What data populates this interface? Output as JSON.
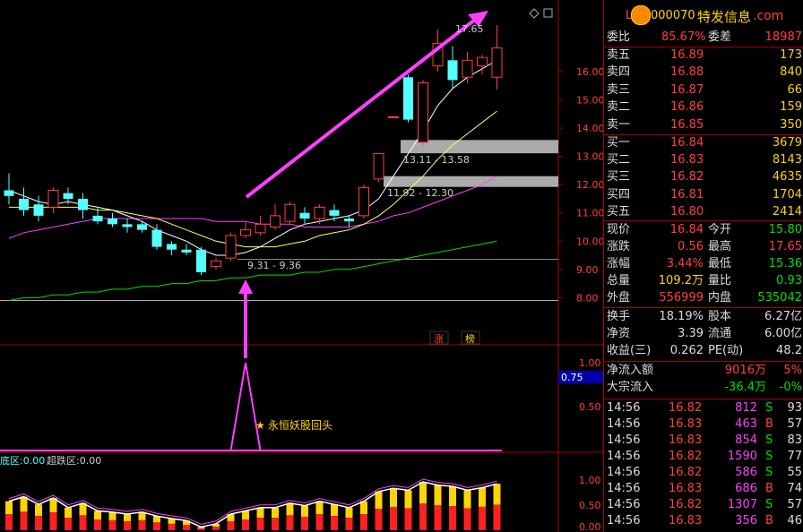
{
  "header": {
    "code": "000070",
    "name": "特发信息",
    "site": ".com",
    "prefix": "L"
  },
  "colors": {
    "up": "#ff4040",
    "down": "#54ffff",
    "ma5": "#ffffff",
    "ma10": "#ffff66",
    "ma20": "#ff40ff",
    "ma60": "#00dd00",
    "accent": "#ff40ff"
  },
  "main_chart": {
    "y_ticks": [
      "16.00",
      "15.00",
      "14.00",
      "13.00",
      "12.00",
      "11.00",
      "10.00",
      "9.00",
      "8.00"
    ],
    "annotations": {
      "high": "17.65",
      "zone_upper": "13.11 - 13.58",
      "zone_mid": "11.92 - 12.30",
      "zone_low": "9.31 - 9.36"
    },
    "badges": [
      "涨",
      "榜"
    ]
  },
  "mid_chart": {
    "y_ticks": [
      "1.00",
      "0.50"
    ],
    "current": "0.75",
    "signal_label": "永恒妖股回头"
  },
  "bottom_chart": {
    "label1": "底区:",
    "value1": "0.00",
    "label2": "超跌区:",
    "value2": "0.00",
    "y_ticks": [
      "1.00",
      "0.50",
      "0.00"
    ]
  },
  "quote": {
    "weibi_label": "委比",
    "weibi": "85.67%",
    "weicha_label": "委差",
    "weicha": "18987",
    "asks": [
      {
        "label": "卖五",
        "price": "16.89",
        "vol": "173"
      },
      {
        "label": "卖四",
        "price": "16.88",
        "vol": "840"
      },
      {
        "label": "卖三",
        "price": "16.87",
        "vol": "66"
      },
      {
        "label": "卖二",
        "price": "16.86",
        "vol": "159"
      },
      {
        "label": "卖一",
        "price": "16.85",
        "vol": "350"
      }
    ],
    "bids": [
      {
        "label": "买一",
        "price": "16.84",
        "vol": "3679"
      },
      {
        "label": "买二",
        "price": "16.83",
        "vol": "8143"
      },
      {
        "label": "买三",
        "price": "16.82",
        "vol": "4635"
      },
      {
        "label": "买四",
        "price": "16.81",
        "vol": "1704"
      },
      {
        "label": "买五",
        "price": "16.80",
        "vol": "2414"
      }
    ],
    "stats": [
      {
        "l1": "现价",
        "v1": "16.84",
        "c1": "r",
        "l2": "今开",
        "v2": "15.80",
        "c2": "g"
      },
      {
        "l1": "涨跌",
        "v1": "0.56",
        "c1": "r",
        "l2": "最高",
        "v2": "17.65",
        "c2": "r"
      },
      {
        "l1": "涨幅",
        "v1": "3.44%",
        "c1": "r",
        "l2": "最低",
        "v2": "15.36",
        "c2": "g"
      },
      {
        "l1": "总量",
        "v1": "109.2万",
        "c1": "y",
        "l2": "量比",
        "v2": "0.93",
        "c2": "g"
      },
      {
        "l1": "外盘",
        "v1": "556999",
        "c1": "r",
        "l2": "内盘",
        "v2": "535042",
        "c2": "g"
      }
    ],
    "stats2": [
      {
        "l1": "换手",
        "v1": "18.19%",
        "l2": "股本",
        "v2": "6.27亿"
      },
      {
        "l1": "净资",
        "v1": "3.39",
        "l2": "流通",
        "v2": "6.00亿"
      },
      {
        "l1": "收益(三)",
        "v1": "0.262",
        "l2": "PE(动)",
        "v2": "48.2"
      }
    ],
    "flow": [
      {
        "label": "净流入额",
        "value": "9016万",
        "pct": "5%",
        "color": "r"
      },
      {
        "label": "大宗流入",
        "value": "-36.4万",
        "pct": "-0%",
        "color": "g"
      }
    ],
    "ticks": [
      {
        "time": "14:56",
        "price": "16.82",
        "vol": "812",
        "side": "S",
        "n": "93"
      },
      {
        "time": "14:56",
        "price": "16.83",
        "vol": "463",
        "side": "B",
        "n": "57"
      },
      {
        "time": "14:56",
        "price": "16.83",
        "vol": "854",
        "side": "S",
        "n": "83"
      },
      {
        "time": "14:56",
        "price": "16.82",
        "vol": "1590",
        "side": "S",
        "n": "77"
      },
      {
        "time": "14:56",
        "price": "16.82",
        "vol": "586",
        "side": "S",
        "n": "55"
      },
      {
        "time": "14:56",
        "price": "16.83",
        "vol": "686",
        "side": "B",
        "n": "74"
      },
      {
        "time": "14:56",
        "price": "16.82",
        "vol": "1307",
        "side": "S",
        "n": "57"
      },
      {
        "time": "14:56",
        "price": "16.83",
        "vol": "356",
        "side": "B",
        "n": "46"
      }
    ]
  },
  "chart_data": {
    "type": "candlestick",
    "ylim": [
      7.6,
      17.9
    ],
    "candles": [
      {
        "o": 11.8,
        "c": 11.6,
        "h": 12.4,
        "l": 11.3
      },
      {
        "o": 11.5,
        "c": 11.1,
        "h": 11.9,
        "l": 10.9
      },
      {
        "o": 11.3,
        "c": 10.9,
        "h": 11.6,
        "l": 10.7
      },
      {
        "o": 11.2,
        "c": 11.8,
        "h": 11.9,
        "l": 11.0
      },
      {
        "o": 11.7,
        "c": 11.5,
        "h": 11.9,
        "l": 11.3
      },
      {
        "o": 11.5,
        "c": 11.1,
        "h": 11.7,
        "l": 10.8
      },
      {
        "o": 10.9,
        "c": 10.7,
        "h": 11.2,
        "l": 10.6
      },
      {
        "o": 10.8,
        "c": 10.6,
        "h": 11.0,
        "l": 10.5
      },
      {
        "o": 10.6,
        "c": 10.5,
        "h": 10.8,
        "l": 10.3
      },
      {
        "o": 10.6,
        "c": 10.4,
        "h": 10.7,
        "l": 10.3
      },
      {
        "o": 10.4,
        "c": 9.8,
        "h": 10.6,
        "l": 9.7
      },
      {
        "o": 9.9,
        "c": 9.7,
        "h": 10.0,
        "l": 9.5
      },
      {
        "o": 9.7,
        "c": 9.6,
        "h": 9.9,
        "l": 9.5
      },
      {
        "o": 9.7,
        "c": 8.9,
        "h": 9.8,
        "l": 8.8
      },
      {
        "o": 9.1,
        "c": 9.3,
        "h": 9.4,
        "l": 9.0
      },
      {
        "o": 9.4,
        "c": 10.2,
        "h": 10.3,
        "l": 9.3
      },
      {
        "o": 10.2,
        "c": 10.4,
        "h": 10.7,
        "l": 10.1
      },
      {
        "o": 10.3,
        "c": 10.6,
        "h": 10.9,
        "l": 10.2
      },
      {
        "o": 10.5,
        "c": 10.9,
        "h": 11.3,
        "l": 10.4
      },
      {
        "o": 10.7,
        "c": 11.3,
        "h": 11.4,
        "l": 10.6
      },
      {
        "o": 11.0,
        "c": 10.8,
        "h": 11.2,
        "l": 10.6
      },
      {
        "o": 10.8,
        "c": 11.2,
        "h": 11.3,
        "l": 10.6
      },
      {
        "o": 11.1,
        "c": 10.9,
        "h": 11.3,
        "l": 10.7
      },
      {
        "o": 10.8,
        "c": 10.7,
        "h": 10.9,
        "l": 10.5
      },
      {
        "o": 10.9,
        "c": 11.9,
        "h": 12.0,
        "l": 10.8
      },
      {
        "o": 12.2,
        "c": 13.1,
        "h": 13.1,
        "l": 12.1
      },
      {
        "o": 14.4,
        "c": 14.4,
        "h": 14.4,
        "l": 14.4
      },
      {
        "o": 15.8,
        "c": 14.3,
        "h": 15.9,
        "l": 14.2
      },
      {
        "o": 13.5,
        "c": 15.6,
        "h": 15.7,
        "l": 13.4
      },
      {
        "o": 16.2,
        "c": 17.0,
        "h": 17.5,
        "l": 16.0
      },
      {
        "o": 16.4,
        "c": 15.7,
        "h": 16.9,
        "l": 15.4
      },
      {
        "o": 15.8,
        "c": 16.4,
        "h": 16.7,
        "l": 15.6
      },
      {
        "o": 16.2,
        "c": 16.5,
        "h": 16.6,
        "l": 15.9
      },
      {
        "o": 15.8,
        "c": 16.84,
        "h": 17.65,
        "l": 15.36
      }
    ],
    "ma5": [
      11.8,
      11.6,
      11.4,
      11.3,
      11.4,
      11.3,
      11.2,
      11.1,
      10.9,
      10.7,
      10.4,
      10.2,
      10.0,
      9.7,
      9.5,
      9.5,
      9.6,
      9.8,
      10.1,
      10.4,
      10.6,
      10.7,
      10.8,
      10.9,
      11.1,
      11.5,
      12.3,
      13.1,
      13.9,
      14.8,
      15.4,
      15.8,
      16.1,
      16.4
    ],
    "ma10": [
      11.2,
      11.2,
      11.2,
      11.2,
      11.2,
      11.2,
      11.1,
      11.1,
      11.0,
      10.9,
      10.8,
      10.6,
      10.4,
      10.2,
      10.0,
      9.9,
      9.8,
      9.8,
      9.8,
      9.9,
      10.0,
      10.2,
      10.3,
      10.4,
      10.6,
      10.9,
      11.3,
      11.8,
      12.3,
      12.9,
      13.4,
      13.8,
      14.2,
      14.6
    ],
    "ma20": [
      10.1,
      10.3,
      10.4,
      10.5,
      10.6,
      10.7,
      10.8,
      10.8,
      10.8,
      10.8,
      10.8,
      10.8,
      10.8,
      10.8,
      10.7,
      10.7,
      10.7,
      10.6,
      10.6,
      10.6,
      10.5,
      10.5,
      10.5,
      10.5,
      10.6,
      10.7,
      10.9,
      11.0,
      11.2,
      11.4,
      11.6,
      11.8,
      12.0,
      12.3
    ],
    "ma60": [
      7.9,
      8.0,
      8.0,
      8.1,
      8.1,
      8.2,
      8.2,
      8.3,
      8.3,
      8.4,
      8.4,
      8.5,
      8.5,
      8.6,
      8.6,
      8.7,
      8.7,
      8.8,
      8.8,
      8.8,
      8.9,
      8.9,
      9.0,
      9.0,
      9.1,
      9.2,
      9.3,
      9.4,
      9.5,
      9.6,
      9.7,
      9.8,
      9.9,
      10.0
    ],
    "zones": [
      {
        "low": 13.11,
        "high": 13.58
      },
      {
        "low": 11.92,
        "high": 12.3
      },
      {
        "low": 9.31,
        "high": 9.36
      }
    ],
    "ref_line": 7.9,
    "signal": [
      0,
      0,
      0,
      0,
      0,
      0,
      0,
      0,
      0,
      0,
      0,
      0,
      0,
      0,
      0,
      0,
      1,
      0,
      0,
      0,
      0,
      0,
      0,
      0,
      0,
      0,
      0,
      0,
      0,
      0,
      0,
      0,
      0,
      0
    ],
    "bottom_bars": [
      0.45,
      0.52,
      0.4,
      0.5,
      0.35,
      0.42,
      0.3,
      0.28,
      0.25,
      0.28,
      0.22,
      0.18,
      0.15,
      0.05,
      0.1,
      0.25,
      0.3,
      0.35,
      0.35,
      0.42,
      0.38,
      0.45,
      0.4,
      0.35,
      0.45,
      0.6,
      0.65,
      0.62,
      0.75,
      0.7,
      0.68,
      0.62,
      0.66,
      0.72
    ]
  }
}
